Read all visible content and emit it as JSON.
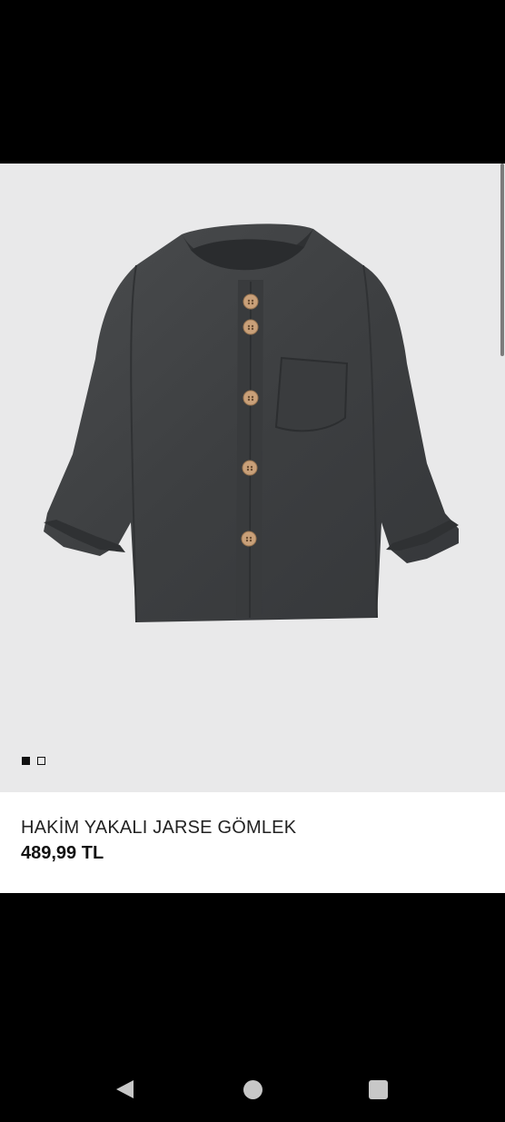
{
  "product": {
    "name": "HAKİM YAKALI JARSE GÖMLEK",
    "price": "489,99 TL",
    "image_description_icon": "product-photo-shirt"
  },
  "gallery": {
    "current_index": 1,
    "total": 2
  },
  "navigation": {
    "back_icon": "triangle-back",
    "home_icon": "circle-home",
    "recents_icon": "square-recents"
  },
  "colors": {
    "image_background": "#e9e9ea",
    "shirt": "#3f4143",
    "button": "#c9a079",
    "nav_icon": "#c7c7c7"
  }
}
